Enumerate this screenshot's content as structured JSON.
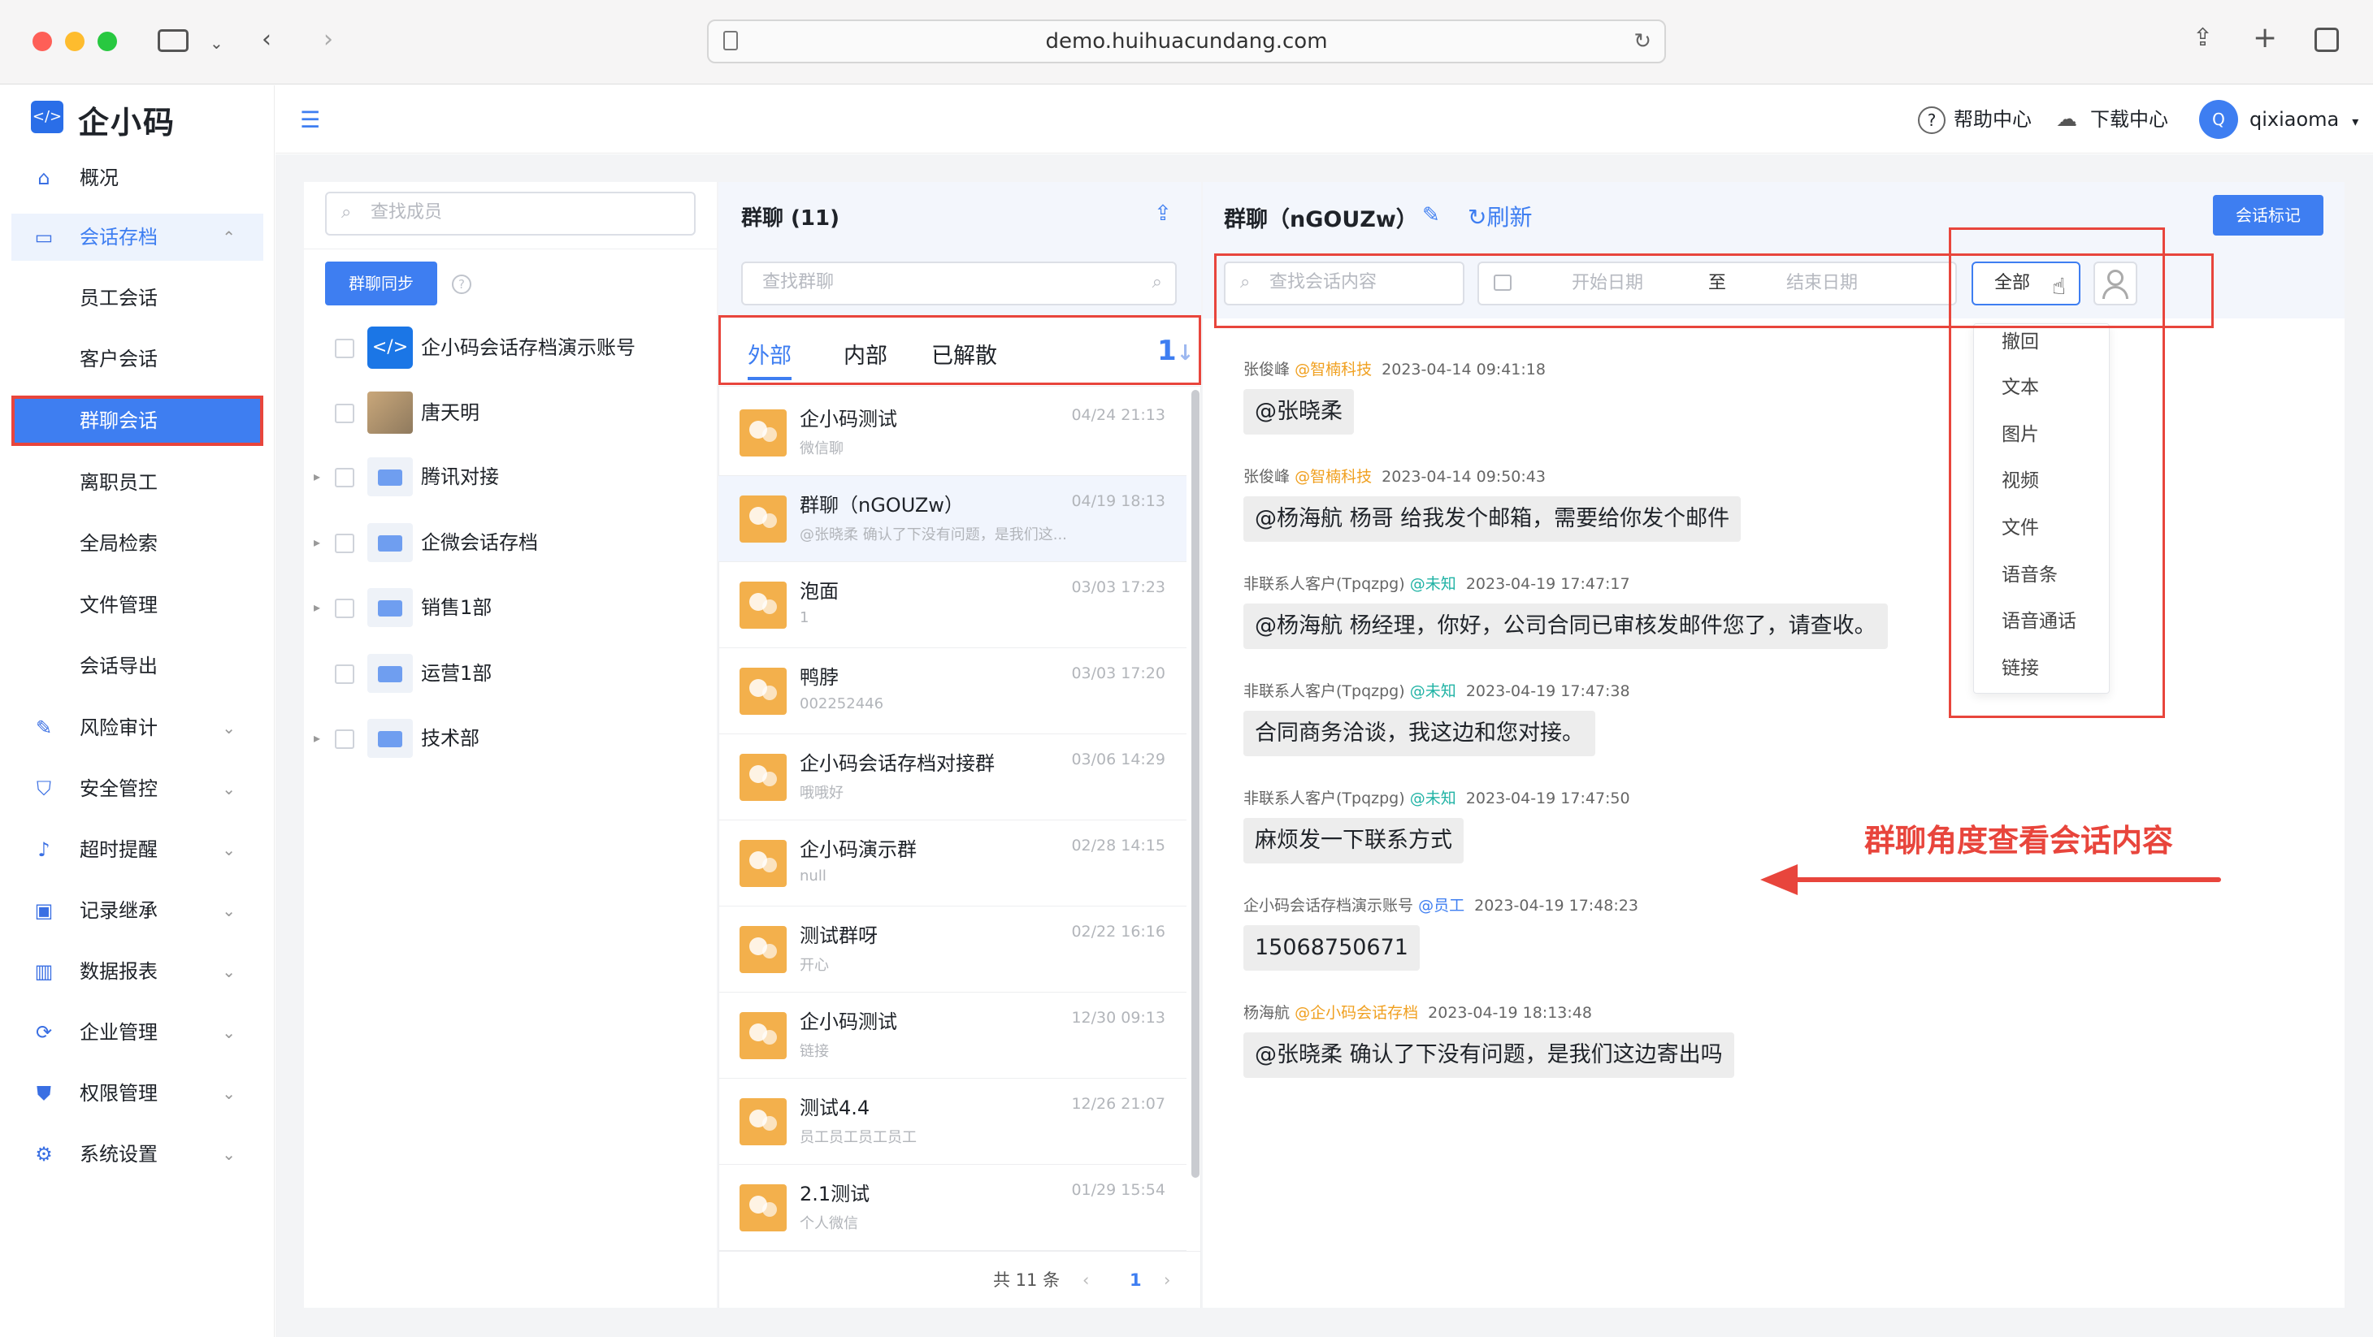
{
  "browser": {
    "url": "demo.huihuacundang.com"
  },
  "app": {
    "logo_text": "企小码"
  },
  "sidebar": {
    "overview": "概况",
    "archive": "会话存档",
    "archive_items": [
      "员工会话",
      "客户会话",
      "群聊会话",
      "离职员工",
      "全局检索",
      "文件管理",
      "会话导出"
    ],
    "groups": [
      "风险审计",
      "安全管控",
      "超时提醒",
      "记录继承",
      "数据报表",
      "企业管理",
      "权限管理",
      "系统设置"
    ]
  },
  "topbar": {
    "help": "帮助中心",
    "download": "下载中心",
    "avatar_letter": "Q",
    "user": "qixiaoma"
  },
  "members": {
    "search_placeholder": "查找成员",
    "sync_button": "群聊同步",
    "help_mark": "?",
    "items": [
      "企小码会话存档演示账号",
      "唐天明",
      "腾讯对接",
      "企微会话存档",
      "销售1部",
      "运营1部",
      "技术部"
    ]
  },
  "groups_panel": {
    "title": "群聊 (11)",
    "search_placeholder": "查找群聊",
    "tabs": [
      "外部",
      "内部",
      "已解散"
    ],
    "sort_glyph": "1",
    "items": [
      {
        "name": "企小码测试",
        "preview": "微信聊",
        "time": "04/24 21:13"
      },
      {
        "name": "群聊（nGOUZw）",
        "preview": "@张晓柔 确认了下没有问题，是我们这...",
        "time": "04/19 18:13"
      },
      {
        "name": "泡面",
        "preview": "1",
        "time": "03/03 17:23"
      },
      {
        "name": "鸭脖",
        "preview": "002252446",
        "time": "03/03 17:20"
      },
      {
        "name": "企小码会话存档对接群",
        "preview": "哦哦好",
        "time": "03/06 14:29"
      },
      {
        "name": "企小码演示群",
        "preview": "null",
        "time": "02/28 14:15"
      },
      {
        "name": "测试群呀",
        "preview": "开心",
        "time": "02/22 16:16"
      },
      {
        "name": "企小码测试",
        "preview": "链接",
        "time": "12/30 09:13"
      },
      {
        "name": "测试4.4",
        "preview": "员工员工员工员工",
        "time": "12/26 21:07"
      },
      {
        "name": "2.1测试",
        "preview": "个人微信",
        "time": "01/29 15:54"
      }
    ],
    "total": "共 11 条",
    "page": "1",
    "prev": "‹",
    "next": "›"
  },
  "conversation": {
    "title": "群聊（nGOUZw）",
    "refresh": "刷新",
    "mark_button": "会话标记",
    "search_placeholder": "查找会话内容",
    "start_date": "开始日期",
    "to": "至",
    "end_date": "结束日期",
    "filter_value": "全部",
    "dropdown": [
      "撤回",
      "文本",
      "图片",
      "视频",
      "文件",
      "语音条",
      "语音通话",
      "链接"
    ],
    "messages": [
      {
        "sender": "张俊峰",
        "tag": "@智楠科技",
        "time": "2023-04-14 09:41:18",
        "text": "@张晓柔"
      },
      {
        "sender": "张俊峰",
        "tag": "@智楠科技",
        "time": "2023-04-14 09:50:43",
        "text": "@杨海航 杨哥 给我发个邮箱，需要给你发个邮件"
      },
      {
        "sender": "非联系人客户(Tpqzpg)",
        "tag": "@未知",
        "time": "2023-04-19 17:47:17",
        "text": "@杨海航 杨经理，你好，公司合同已审核发邮件您了，请查收。"
      },
      {
        "sender": "非联系人客户(Tpqzpg)",
        "tag": "@未知",
        "time": "2023-04-19 17:47:38",
        "text": "合同商务洽谈，我这边和您对接。"
      },
      {
        "sender": "非联系人客户(Tpqzpg)",
        "tag": "@未知",
        "time": "2023-04-19 17:47:50",
        "text": "麻烦发一下联系方式"
      },
      {
        "sender": "企小码会话存档演示账号",
        "tag": "@员工",
        "time": "2023-04-19 17:48:23",
        "text": "15068750671"
      },
      {
        "sender": "杨海航",
        "tag": "@企小码会话存档",
        "time": "2023-04-19 18:13:48",
        "text": "@张晓柔 确认了下没有问题，是我们这边寄出吗"
      }
    ],
    "annotation": "群聊角度查看会话内容"
  },
  "colors": {
    "accent": "#3e7ef1",
    "highlight": "#e8453c",
    "avatar": "#f3b04c"
  }
}
